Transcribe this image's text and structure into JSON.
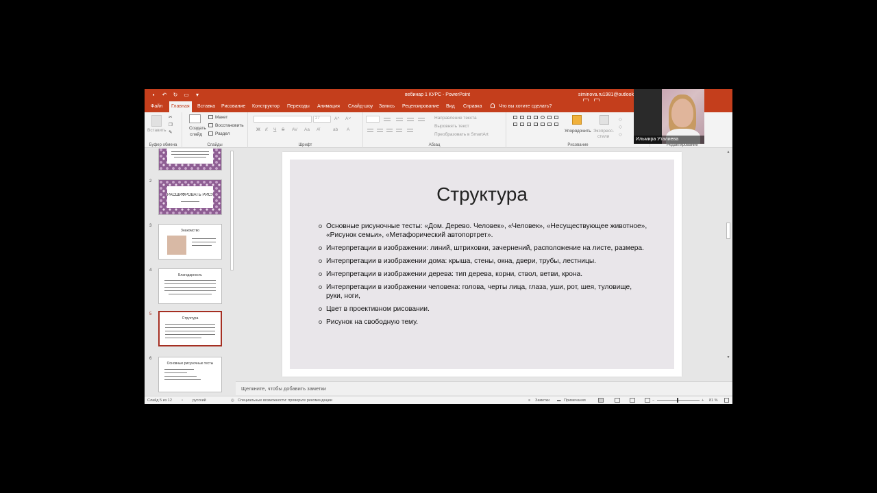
{
  "titlebar": {
    "document_title": "вебинар 1 КУРС - PowerPoint",
    "user_email": "siminova.ru1981@outlook"
  },
  "tabs": [
    {
      "label": "Файл",
      "active": false
    },
    {
      "label": "Главная",
      "active": true
    },
    {
      "label": "Вставка",
      "active": false
    },
    {
      "label": "Рисование",
      "active": false
    },
    {
      "label": "Конструктор",
      "active": false
    },
    {
      "label": "Переходы",
      "active": false
    },
    {
      "label": "Анимация",
      "active": false
    },
    {
      "label": "Слайд-шоу",
      "active": false
    },
    {
      "label": "Запись",
      "active": false
    },
    {
      "label": "Рецензирование",
      "active": false
    },
    {
      "label": "Вид",
      "active": false
    },
    {
      "label": "Справка",
      "active": false
    }
  ],
  "tell_me": "Что вы хотите сделать?",
  "ribbon": {
    "clipboard": {
      "paste": "Вставить",
      "group": "Буфер обмена"
    },
    "slides": {
      "new_slide_1": "Создать",
      "new_slide_2": "слайд",
      "layout": "Макет",
      "reset": "Восстановить",
      "section": "Раздел",
      "group": "Слайды"
    },
    "font": {
      "size": "27",
      "group": "Шрифт"
    },
    "paragraph": {
      "text_direction": "Направление текста",
      "align_text": "Выровнять текст",
      "smartart": "Преобразовать в SmartArt",
      "group": "Абзац"
    },
    "drawing": {
      "arrange": "Упорядочить",
      "quick_styles_1": "Экспресс-",
      "quick_styles_2": "стили",
      "group": "Рисование"
    },
    "editing": {
      "group": "Редактирование"
    }
  },
  "slides": [
    {
      "number": "2",
      "title": "РАСШИФРОВАТЬ РИСУНОК"
    },
    {
      "number": "3",
      "title": "Знакомство"
    },
    {
      "number": "4",
      "title": "Благодарность"
    },
    {
      "number": "5",
      "title": "Структура"
    },
    {
      "number": "6",
      "title": "Основные рисуночные тесты"
    }
  ],
  "current_slide": {
    "title": "Структура",
    "bullets": [
      "Основные рисуночные тесты: «Дом. Дерево. Человек», «Человек», «Несуществующее животное», «Рисунок семьи», «Метафорический автопортрет».",
      "Интерпретации в изображении: линий, штриховки, зачернений, расположение на листе, размера.",
      "Интерпретации в изображении дома: крыша, стены, окна, двери, трубы, лестницы.",
      "Интерпретации в изображении дерева: тип дерева, корни, ствол, ветви, крона.",
      "Интерпретации в изображении человека: голова, черты лица, глаза, уши, рот, шея, туловище, руки, ноги,",
      "Цвет в проективном рисовании.",
      "Рисунок на свободную тему."
    ]
  },
  "notes_placeholder": "Щелкните, чтобы добавить заметки",
  "statusbar": {
    "slide_counter": "Слайд 5 из 12",
    "language": "русский",
    "accessibility": "Специальные возможности: проверьте рекомендации",
    "notes": "Заметки",
    "comments": "Примечания",
    "zoom": "81 %"
  },
  "webcam": {
    "name": "Ильмира Уталиева"
  },
  "colors": {
    "accent": "#c43e1c",
    "selected_thumb": "#a52f22",
    "slide_bg": "#e9e6ea"
  }
}
